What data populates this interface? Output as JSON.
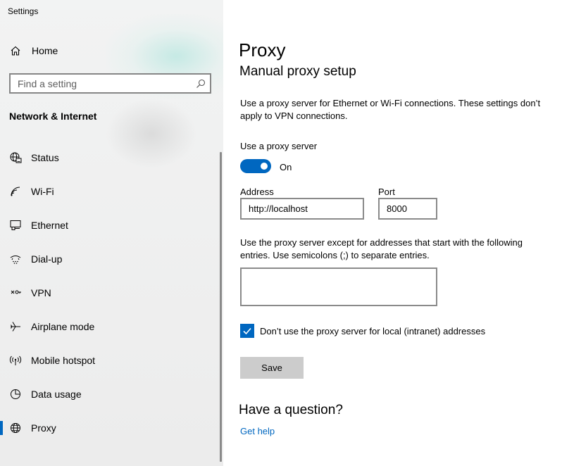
{
  "window": {
    "title": "Settings"
  },
  "sidebar": {
    "home_label": "Home",
    "search": {
      "placeholder": "Find a setting",
      "value": ""
    },
    "section_title": "Network & Internet",
    "items": [
      {
        "label": "Status",
        "icon": "globe-status-icon",
        "active": false
      },
      {
        "label": "Wi-Fi",
        "icon": "wifi-icon",
        "active": false
      },
      {
        "label": "Ethernet",
        "icon": "ethernet-icon",
        "active": false
      },
      {
        "label": "Dial-up",
        "icon": "dialup-icon",
        "active": false
      },
      {
        "label": "VPN",
        "icon": "vpn-icon",
        "active": false
      },
      {
        "label": "Airplane mode",
        "icon": "airplane-icon",
        "active": false
      },
      {
        "label": "Mobile hotspot",
        "icon": "hotspot-icon",
        "active": false
      },
      {
        "label": "Data usage",
        "icon": "data-usage-icon",
        "active": false
      },
      {
        "label": "Proxy",
        "icon": "globe-icon",
        "active": true
      }
    ]
  },
  "main": {
    "title": "Proxy",
    "subtitle": "Manual proxy setup",
    "description": "Use a proxy server for Ethernet or Wi-Fi connections. These settings don’t apply to VPN connections.",
    "use_proxy_label": "Use a proxy server",
    "toggle_state": "On",
    "address_label": "Address",
    "address_value": "http://localhost",
    "port_label": "Port",
    "port_value": "8000",
    "exceptions_description": "Use the proxy server except for addresses that start with the following entries. Use semicolons (;) to separate entries.",
    "exceptions_value": "",
    "local_checkbox_label": "Don’t use the proxy server for local (intranet) addresses",
    "local_checkbox_checked": true,
    "save_label": "Save",
    "question_title": "Have a question?",
    "help_link": "Get help"
  },
  "colors": {
    "accent": "#0067c0",
    "sidebar_bg": "#f2f3f3",
    "button_bg": "#cccccc"
  }
}
